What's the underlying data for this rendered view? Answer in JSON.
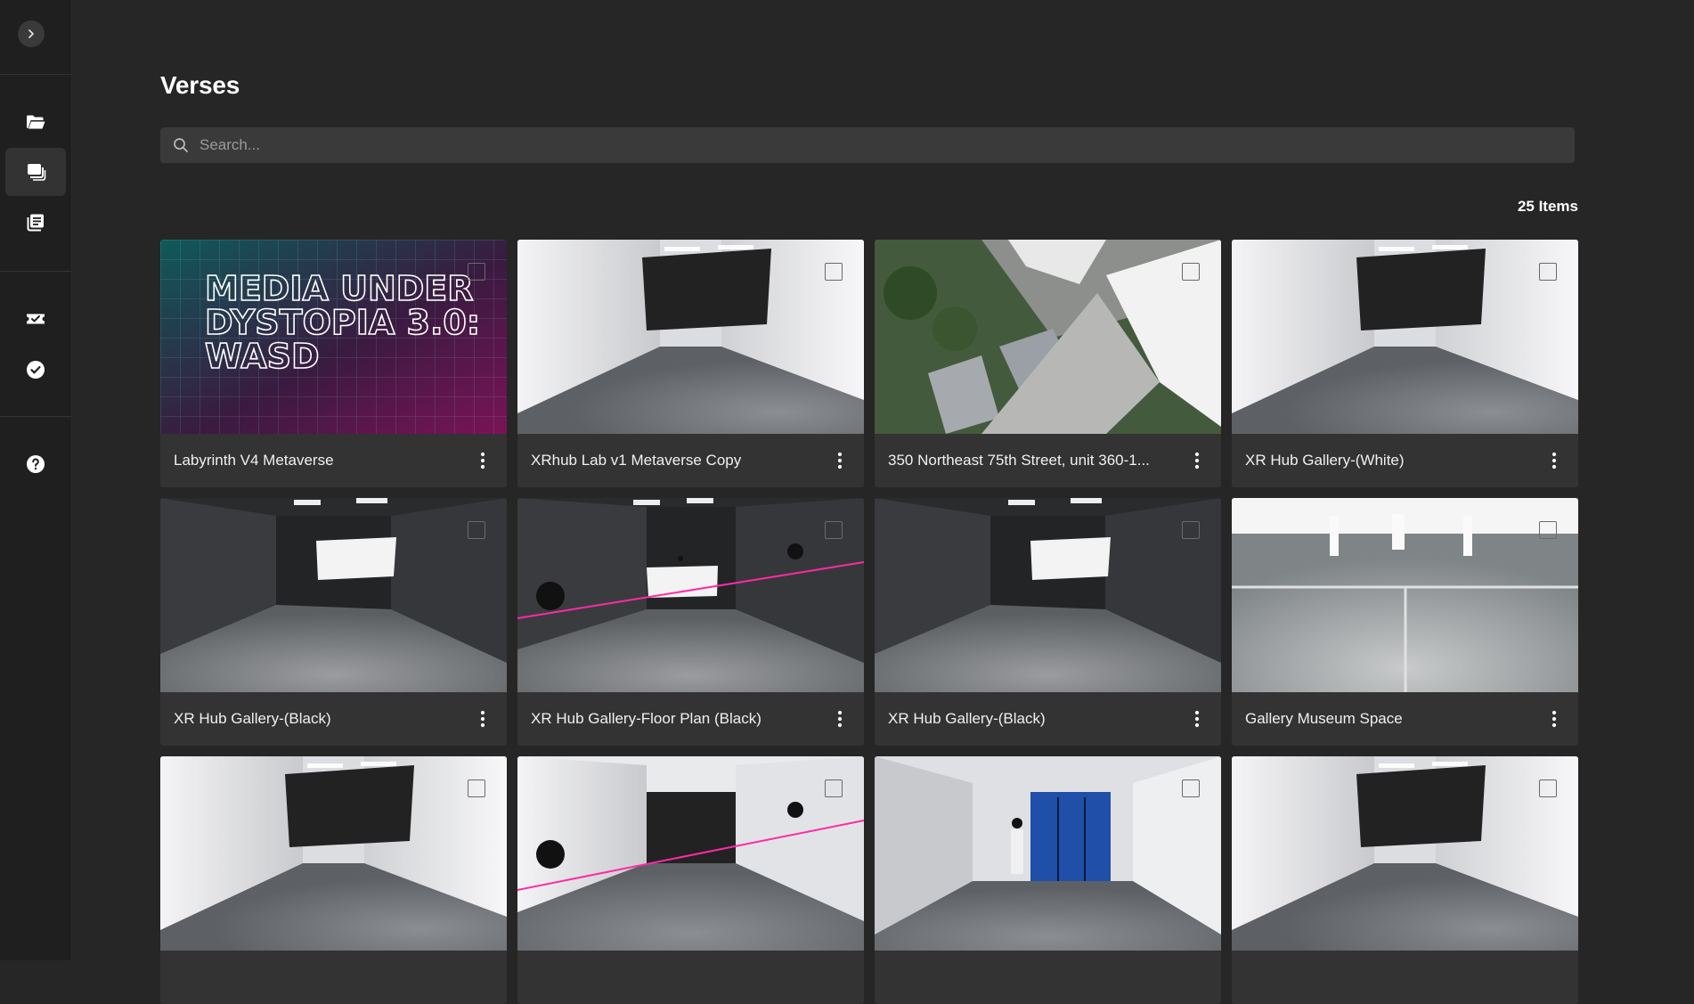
{
  "page": {
    "title": "Verses",
    "search_placeholder": "Search...",
    "item_count": "25 Items"
  },
  "sidebar": {
    "items": [
      {
        "icon": "folder-open-icon",
        "active": false
      },
      {
        "icon": "stacked-images-icon",
        "active": true
      },
      {
        "icon": "library-icon",
        "active": false
      },
      {
        "icon": "ticket-check-icon",
        "active": false
      },
      {
        "icon": "check-circle-icon",
        "active": false
      },
      {
        "icon": "help-icon",
        "active": false
      }
    ]
  },
  "cards": [
    {
      "title": "Labyrinth V4 Metaverse",
      "thumb": "poster",
      "poster_text": [
        "MEDIA UNDER",
        "DYSTOPIA 3.0:",
        "WASD"
      ]
    },
    {
      "title": "XRhub Lab v1 Metaverse Copy",
      "thumb": "white-room"
    },
    {
      "title": "350 Northeast 75th Street, unit 360-1...",
      "thumb": "aerial"
    },
    {
      "title": "XR Hub Gallery-(White)",
      "thumb": "white-room"
    },
    {
      "title": "XR Hub Gallery-(Black)",
      "thumb": "black-room"
    },
    {
      "title": "XR Hub Gallery-Floor Plan (Black)",
      "thumb": "black-room-measure"
    },
    {
      "title": "XR Hub Gallery-(Black)",
      "thumb": "black-room"
    },
    {
      "title": "Gallery Museum Space",
      "thumb": "museum"
    },
    {
      "title": "",
      "thumb": "white-room"
    },
    {
      "title": "",
      "thumb": "white-room-measure"
    },
    {
      "title": "",
      "thumb": "white-room-door"
    },
    {
      "title": "",
      "thumb": "white-room"
    }
  ],
  "colors": {
    "background": "#262626",
    "sidebar": "#1f1f1f",
    "card": "#333333",
    "search": "#3a3a3a",
    "measure_line": "#ff2aa8"
  }
}
